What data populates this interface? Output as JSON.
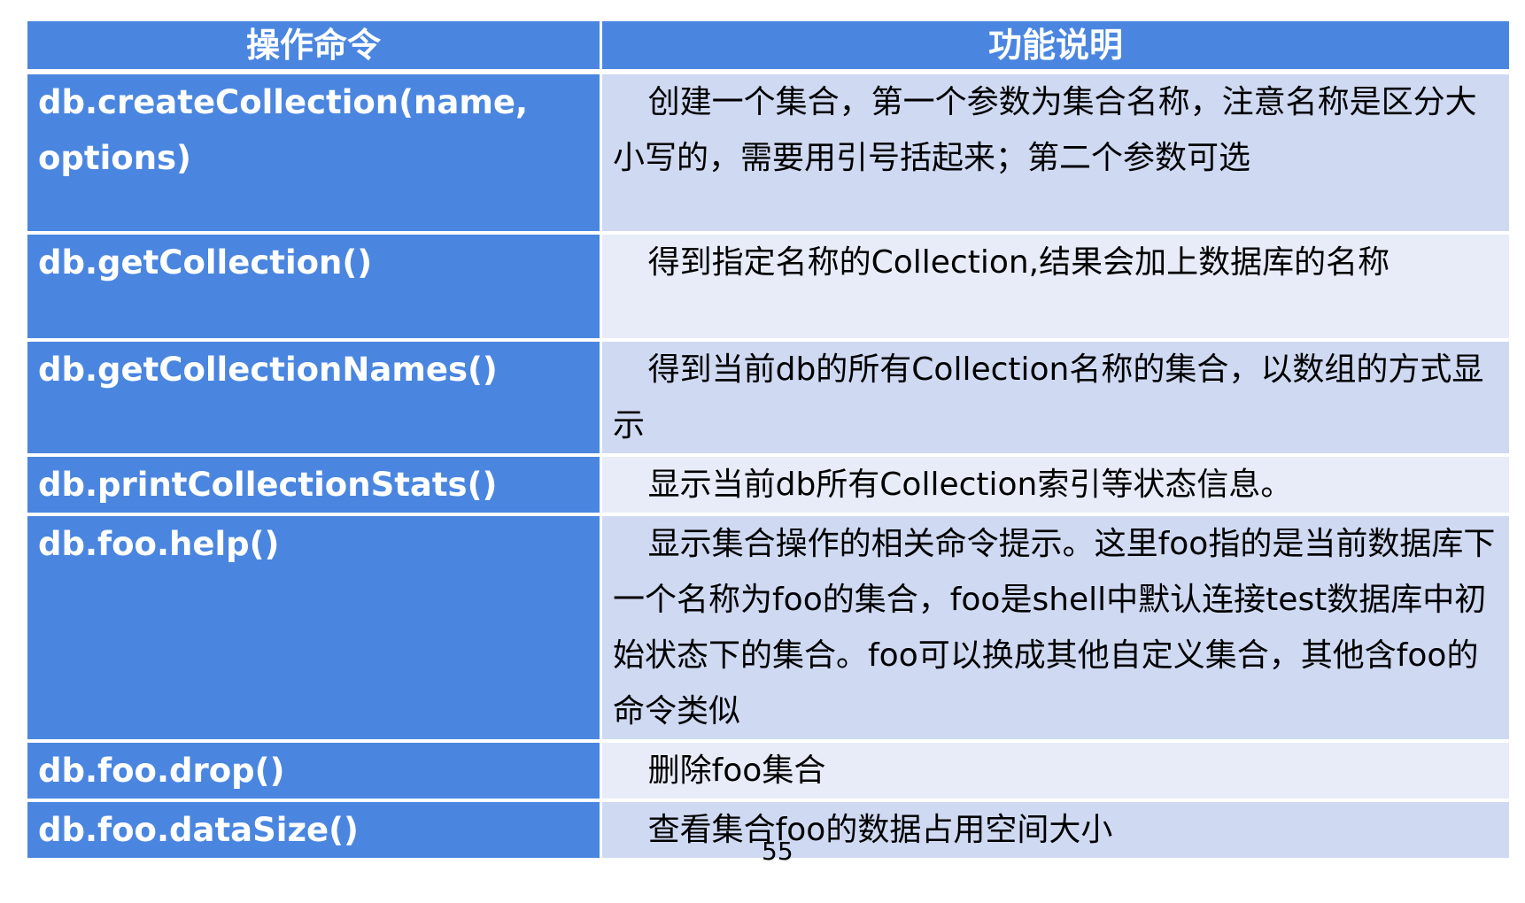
{
  "table": {
    "headers": [
      "操作命令",
      "功能说明"
    ],
    "rows": [
      {
        "command": "db.createCollection(name, options)",
        "description": "创建一个集合，第一个参数为集合名称，注意名称是区分大小写的，需要用引号括起来；第二个参数可选"
      },
      {
        "command": "db.getCollection()",
        "description": "得到指定名称的Collection,结果会加上数据库的名称"
      },
      {
        "command": "db.getCollectionNames()",
        "description": "得到当前db的所有Collection名称的集合，以数组的方式显示"
      },
      {
        "command": "db.printCollectionStats()",
        "description": "显示当前db所有Collection索引等状态信息。"
      },
      {
        "command": "db.foo.help()",
        "description": "显示集合操作的相关命令提示。这里foo指的是当前数据库下一个名称为foo的集合，foo是shell中默认连接test数据库中初始状态下的集合。foo可以换成其他自定义集合，其他含foo的命令类似"
      },
      {
        "command": "db.foo.drop()",
        "description": "删除foo集合"
      },
      {
        "command": "db.foo.dataSize()",
        "description": "查看集合foo的数据占用空间大小"
      }
    ]
  },
  "page_number": "55",
  "colors": {
    "header_bg": "#4a86e0",
    "row_odd": "#cfd9f2",
    "row_even": "#e8ecf8"
  }
}
